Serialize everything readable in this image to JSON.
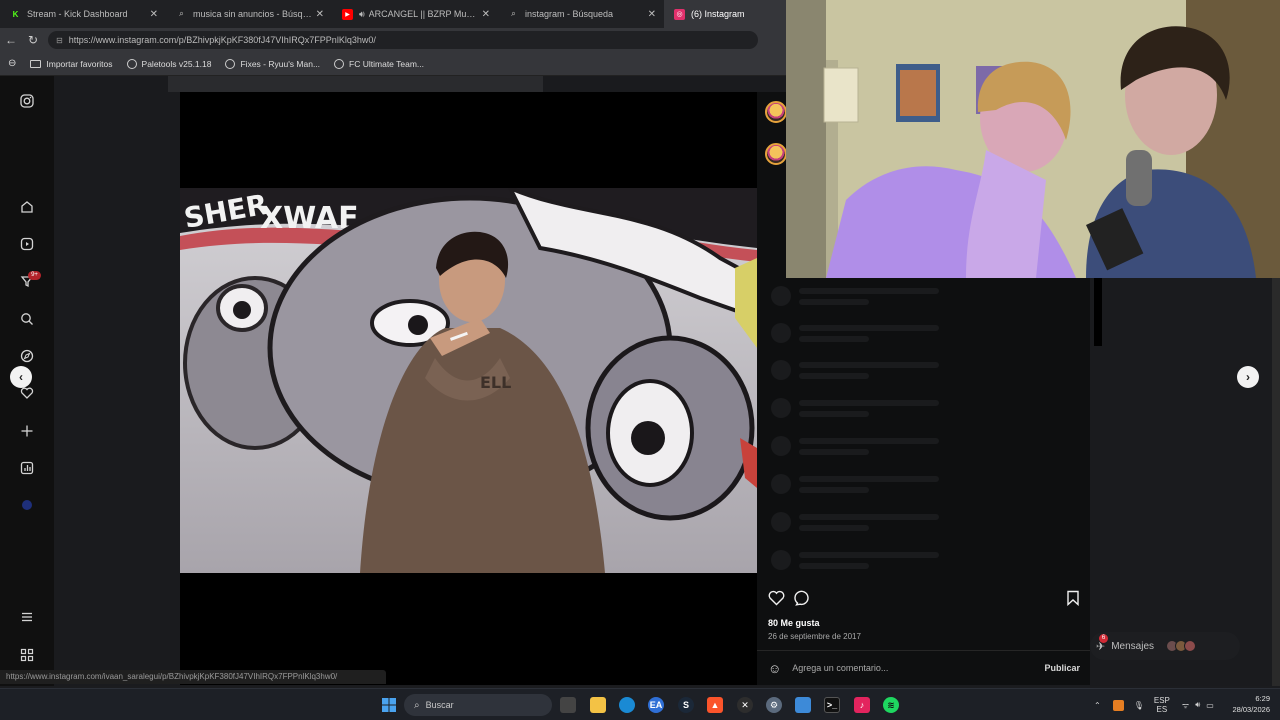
{
  "browser": {
    "tabs": [
      {
        "label": "Stream - Kick Dashboard",
        "icon": "kick-icon",
        "color": "#53fc18",
        "active": false
      },
      {
        "label": "musica sin anuncios - Búsqueda",
        "icon": "search-icon",
        "color": "#888888",
        "active": false
      },
      {
        "label": "ARCANGEL || BZRP Music Ses",
        "icon": "youtube-icon",
        "color": "#ff0000",
        "active": false
      },
      {
        "label": "instagram - Búsqueda",
        "icon": "search-icon",
        "color": "#888888",
        "active": false
      },
      {
        "label": "(6) Instagram",
        "icon": "instagram-icon",
        "color": "#e1306c",
        "active": true
      }
    ],
    "url": "https://www.instagram.com/p/BZhivpkjKpKF380fJ47VIhIRQx7FPPnlKlq3hw0/",
    "bookmarks": [
      {
        "label": "Importar favoritos"
      },
      {
        "label": "Paletools v25.1.18"
      },
      {
        "label": "Fixes - Ryuu's Man..."
      },
      {
        "label": "FC Ultimate Team..."
      }
    ],
    "status_url": "https://www.instagram.com/ivaan_saralegui/p/BZhivpkjKpKF380fJ47VIhIRQx7FPPnlKlq3hw0/"
  },
  "instagram": {
    "notification_badge": "9+",
    "post": {
      "likes": "80 Me gusta",
      "date": "26 de septiembre de 2017",
      "comment_placeholder": "Agrega un comentario...",
      "publish_label": "Publicar"
    },
    "messages_label": "Mensajes",
    "messages_badge": "6"
  },
  "taskbar": {
    "search_placeholder": "Buscar",
    "lang_top": "ESP",
    "lang_bottom": "ES",
    "time": "6:29",
    "date": "28/03/2026"
  }
}
